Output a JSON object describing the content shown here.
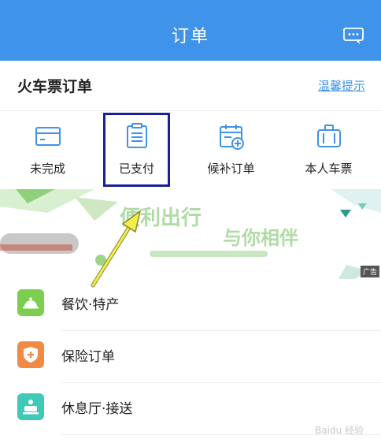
{
  "header": {
    "title": "订单",
    "message_icon": "chat-bubble-icon"
  },
  "section": {
    "title": "火车票订单",
    "tip_link": "温馨提示"
  },
  "tabs": [
    {
      "label": "未完成",
      "icon": "card-icon"
    },
    {
      "label": "已支付",
      "icon": "receipt-icon"
    },
    {
      "label": "候补订单",
      "icon": "calendar-plus-icon"
    },
    {
      "label": "本人车票",
      "icon": "suitcase-icon"
    }
  ],
  "banner": {
    "headline": "便利出行",
    "subline": "与你相伴",
    "ad_label": "广告"
  },
  "list": [
    {
      "label": "餐饮·特产",
      "icon": "service-bell-icon",
      "color": "#7ccf4e"
    },
    {
      "label": "保险订单",
      "icon": "shield-plus-icon",
      "color": "#f08a45"
    },
    {
      "label": "休息厅·接送",
      "icon": "lounge-icon",
      "color": "#3fcab8"
    }
  ],
  "watermark": "Baidu 经验",
  "colors": {
    "primary": "#3f93e8",
    "highlight_box": "#1a1f9c",
    "annotation_arrow": "#f2ee4a"
  }
}
